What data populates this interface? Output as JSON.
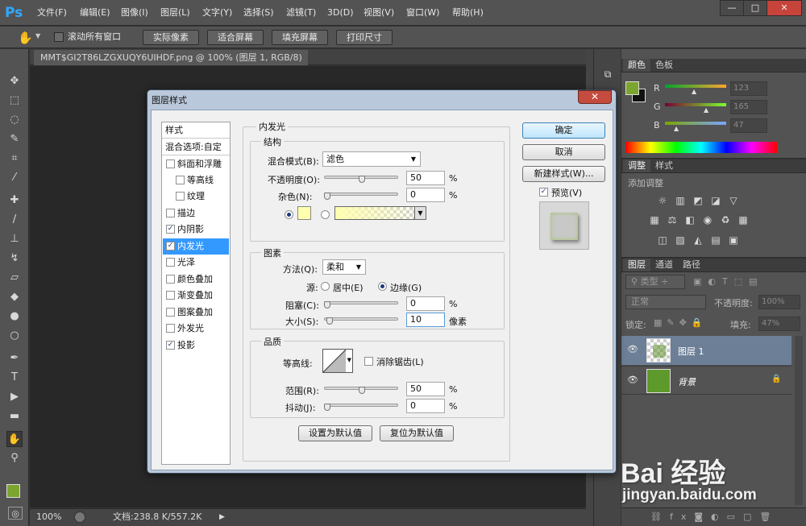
{
  "app": {
    "logo": "Ps",
    "menu": [
      "文件(F)",
      "编辑(E)",
      "图像(I)",
      "图层(L)",
      "文字(Y)",
      "选择(S)",
      "滤镜(T)",
      "3D(D)",
      "视图(V)",
      "窗口(W)",
      "帮助(H)"
    ],
    "window_controls": [
      "—",
      "□",
      "✕"
    ]
  },
  "options": {
    "scroll_all_windows": "滚动所有窗口",
    "buttons": [
      "实际像素",
      "适合屏幕",
      "填充屏幕",
      "打印尺寸"
    ]
  },
  "document": {
    "tab_title": "MMT$GI2T86LZGXUQY6UIHDF.png @ 100% (图层 1, RGB/8) *",
    "tab_close": "✕"
  },
  "status": {
    "zoom": "100%",
    "doc_info": "文档:238.8 K/557.2K"
  },
  "color_panel": {
    "tabs": [
      "颜色",
      "色板"
    ],
    "channels": [
      {
        "name": "R",
        "value": "123"
      },
      {
        "name": "G",
        "value": "165"
      },
      {
        "name": "B",
        "value": "47"
      }
    ],
    "fg_color": "#7ba52f"
  },
  "adjust_panel": {
    "tabs": [
      "调整",
      "样式"
    ],
    "title": "添加调整"
  },
  "layers_panel": {
    "tabs": [
      "图层",
      "通道",
      "路径"
    ],
    "filter": "类型",
    "blend": "正常",
    "opacity_label": "不透明度:",
    "opacity": "100%",
    "lock_label": "锁定:",
    "fill_label": "填充:",
    "fill": "47%",
    "layers": [
      {
        "name": "图层 1",
        "selected": true
      },
      {
        "name": "背景",
        "locked": true
      }
    ]
  },
  "dialog": {
    "title": "图层样式",
    "close": "✕",
    "sidebar": {
      "header": "样式",
      "blend_options": "混合选项:自定",
      "items": [
        {
          "label": "斜面和浮雕",
          "checked": false
        },
        {
          "label": "等高线",
          "checked": false
        },
        {
          "label": "纹理",
          "checked": false
        },
        {
          "label": "描边",
          "checked": false
        },
        {
          "label": "内阴影",
          "checked": true
        },
        {
          "label": "内发光",
          "checked": true,
          "selected": true
        },
        {
          "label": "光泽",
          "checked": false
        },
        {
          "label": "颜色叠加",
          "checked": false
        },
        {
          "label": "渐变叠加",
          "checked": false
        },
        {
          "label": "图案叠加",
          "checked": false
        },
        {
          "label": "外发光",
          "checked": false
        },
        {
          "label": "投影",
          "checked": true
        }
      ]
    },
    "main": {
      "section_title": "内发光",
      "structure": {
        "title": "结构",
        "blend_mode_label": "混合模式(B):",
        "blend_mode": "滤色",
        "opacity_label": "不透明度(O):",
        "opacity": "50",
        "opacity_percent": 0.5,
        "noise_label": "杂色(N):",
        "noise": "0",
        "noise_percent": 0,
        "percent": "%",
        "glow_color": "#ffffb0"
      },
      "elements": {
        "title": "图素",
        "method_label": "方法(Q):",
        "method": "柔和",
        "source_label": "源:",
        "source_center": "居中(E)",
        "source_edge": "边缘(G)",
        "choke_label": "阻塞(C):",
        "choke": "0",
        "choke_percent": 0,
        "size_label": "大小(S):",
        "size": "10",
        "size_percent": 0.04,
        "size_unit": "像素",
        "percent": "%"
      },
      "quality": {
        "title": "品质",
        "contour_label": "等高线:",
        "antialias_label": "消除锯齿(L)",
        "range_label": "范围(R):",
        "range": "50",
        "range_percent": 0.5,
        "jitter_label": "抖动(J):",
        "jitter": "0",
        "jitter_percent": 0,
        "percent": "%"
      },
      "set_default": "设置为默认值",
      "reset_default": "复位为默认值"
    },
    "buttons": {
      "ok": "确定",
      "cancel": "取消",
      "new_style": "新建样式(W)...",
      "preview": "预览(V)"
    }
  },
  "watermark": {
    "text": "Bai 经验",
    "url": "jingyan.baidu.com"
  }
}
